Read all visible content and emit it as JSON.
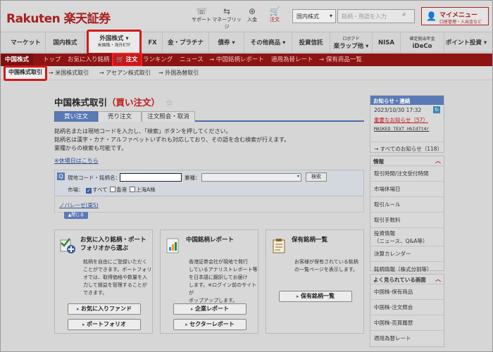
{
  "header": {
    "logo": "Rakuten 楽天証券",
    "icons": [
      {
        "label": "サポート",
        "glyph": "☏",
        "icon": "support-icon"
      },
      {
        "label": "マネーブリッジ",
        "glyph": "⇆",
        "icon": "money-bridge-icon"
      },
      {
        "label": "入金",
        "glyph": "⊕",
        "icon": "deposit-icon"
      },
      {
        "label": "注文",
        "glyph": "🛒",
        "icon": "cart-icon"
      }
    ],
    "market_select": "国内株式",
    "search_placeholder": "銘柄・用語を入力",
    "mymenu_title": "マイメニュー",
    "mymenu_sub": "口座管理・入出金など"
  },
  "main_nav": [
    {
      "label": "マーケット",
      "sub": ""
    },
    {
      "label": "国内株式",
      "sub": ""
    },
    {
      "label": "外国株式 ▾",
      "sub": "米国株・海外ETF"
    },
    {
      "label": "FX",
      "sub": ""
    },
    {
      "label": "金・プラチナ",
      "sub": ""
    },
    {
      "label": "債券 ▾",
      "sub": ""
    },
    {
      "label": "その他商品 ▾",
      "sub": ""
    },
    {
      "label": "投資信託",
      "sub": ""
    },
    {
      "label": "楽ラップ他 ▾",
      "sub": "ロボアド"
    },
    {
      "label": "NISA",
      "sub": ""
    },
    {
      "label": "iDeCo",
      "sub": "確定拠出年金"
    },
    {
      "label": "ポイント投資 ▾",
      "sub": ""
    }
  ],
  "red_bar": [
    "中国株式",
    "トップ",
    "お気に入り銘柄",
    "🛒 注文",
    "ランキング",
    "ニュース",
    "→ 中国銘柄レポート",
    "適用為替レート",
    "→ 保有商品一覧"
  ],
  "sub_nav": [
    "中国株式取引",
    "→ 米国株式取引",
    "→ アセアン株式取引",
    "→ 外国為替取引"
  ],
  "page": {
    "title_main": "中国株式取引",
    "title_paren": "（買い注文）",
    "star": "☆",
    "tabs": [
      "買い注文",
      "売り注文",
      "注文照会・取消"
    ],
    "desc_lines": [
      "銘柄名または現地コードを入力し、「検索」ボタンを押してください。",
      "銘柄名は漢字・カナ・アルファベットいずれも対応しており、その語を含む検索が行えます。",
      "業種からの検索も可能です。"
    ],
    "holiday_link": "※休場日はこちら",
    "search": {
      "code_label": "現地コード・銘柄名：",
      "industry_label": "業種：",
      "button": "検索",
      "market_label": "市場：",
      "opt_all": "すべて",
      "opt_hk": "香港",
      "opt_sh": "上海A株"
    },
    "subsearch_link": "ノバレーゼ(東S)",
    "close_label": "▲閉じる"
  },
  "features": [
    {
      "title": "お気に入り銘柄・ポートフォリオから選ぶ",
      "text": [
        "銘柄を自由にご登録いただく",
        "ことができます。ポートフォリ",
        "オでは、取得価格や数量を入",
        "力して損益を管理することが",
        "できます。"
      ],
      "buttons": [
        "お気に入りファンド",
        "ポートフォリオ"
      ]
    },
    {
      "title": "中国銘柄レポート",
      "text": [
        "香港証券会社が現地で発行",
        "しているアナリストレポート等",
        "を日本語に翻訳してお届け",
        "します。※ログイン前のサイトが",
        "ポップアップします。"
      ],
      "buttons": [
        "企業レポート",
        "セクターレポート"
      ]
    },
    {
      "title": "保有銘柄一覧",
      "text": [
        "お客様が保有されている銘柄",
        "の一覧ページを表示します。"
      ],
      "buttons": [
        "保有銘柄一覧"
      ]
    }
  ],
  "sidebar": {
    "news_head": "お知らせ・連絡",
    "news_date": "2023/10/30 17:32",
    "news_important": "重要なお知らせ（57）",
    "news_masked": "MASKED_TEXT_HkId7t4r",
    "news_all": "→ すべてのお知らせ（118）",
    "info_head": "情報",
    "info_items": [
      "取引時間/注文受付時間",
      "市場休場日",
      "取引ルール",
      "取引手数料",
      "投資情報\n（ニュース、Q&A等）",
      "決算カレンダー",
      "銘柄情報（株式分割等）"
    ],
    "popular_head": "よく見られている画面",
    "popular_items": [
      "中国株-保有商品",
      "中国株-注文照会",
      "中国株-売買履歴",
      "適用為替レート"
    ]
  }
}
